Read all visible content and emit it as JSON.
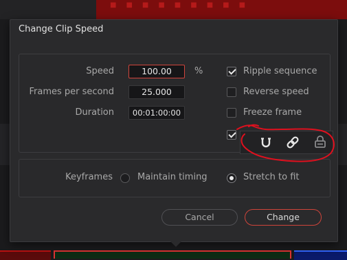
{
  "dialog": {
    "title": "Change Clip Speed"
  },
  "speed": {
    "label": "Speed",
    "value": "100.00",
    "unit": "%"
  },
  "fps": {
    "label": "Frames per second",
    "value": "25.000"
  },
  "duration": {
    "label": "Duration",
    "value": "00:01:00:00"
  },
  "options": {
    "ripple_sequence": {
      "label": "Ripple sequence",
      "checked": true
    },
    "reverse_speed": {
      "label": "Reverse speed",
      "checked": false
    },
    "freeze_frame": {
      "label": "Freeze frame",
      "checked": false
    },
    "fourth_option": {
      "checked": true
    }
  },
  "keyframes": {
    "label": "Keyframes",
    "maintain_timing": "Maintain timing",
    "stretch_to_fit": "Stretch to fit",
    "selected": "stretch_to_fit"
  },
  "buttons": {
    "cancel": "Cancel",
    "change": "Change"
  },
  "toolbar": {
    "icons": [
      "snapping-magnet-icon",
      "linked-selection-icon",
      "position-lock-icon"
    ]
  },
  "annotation_color": "#e0101e"
}
